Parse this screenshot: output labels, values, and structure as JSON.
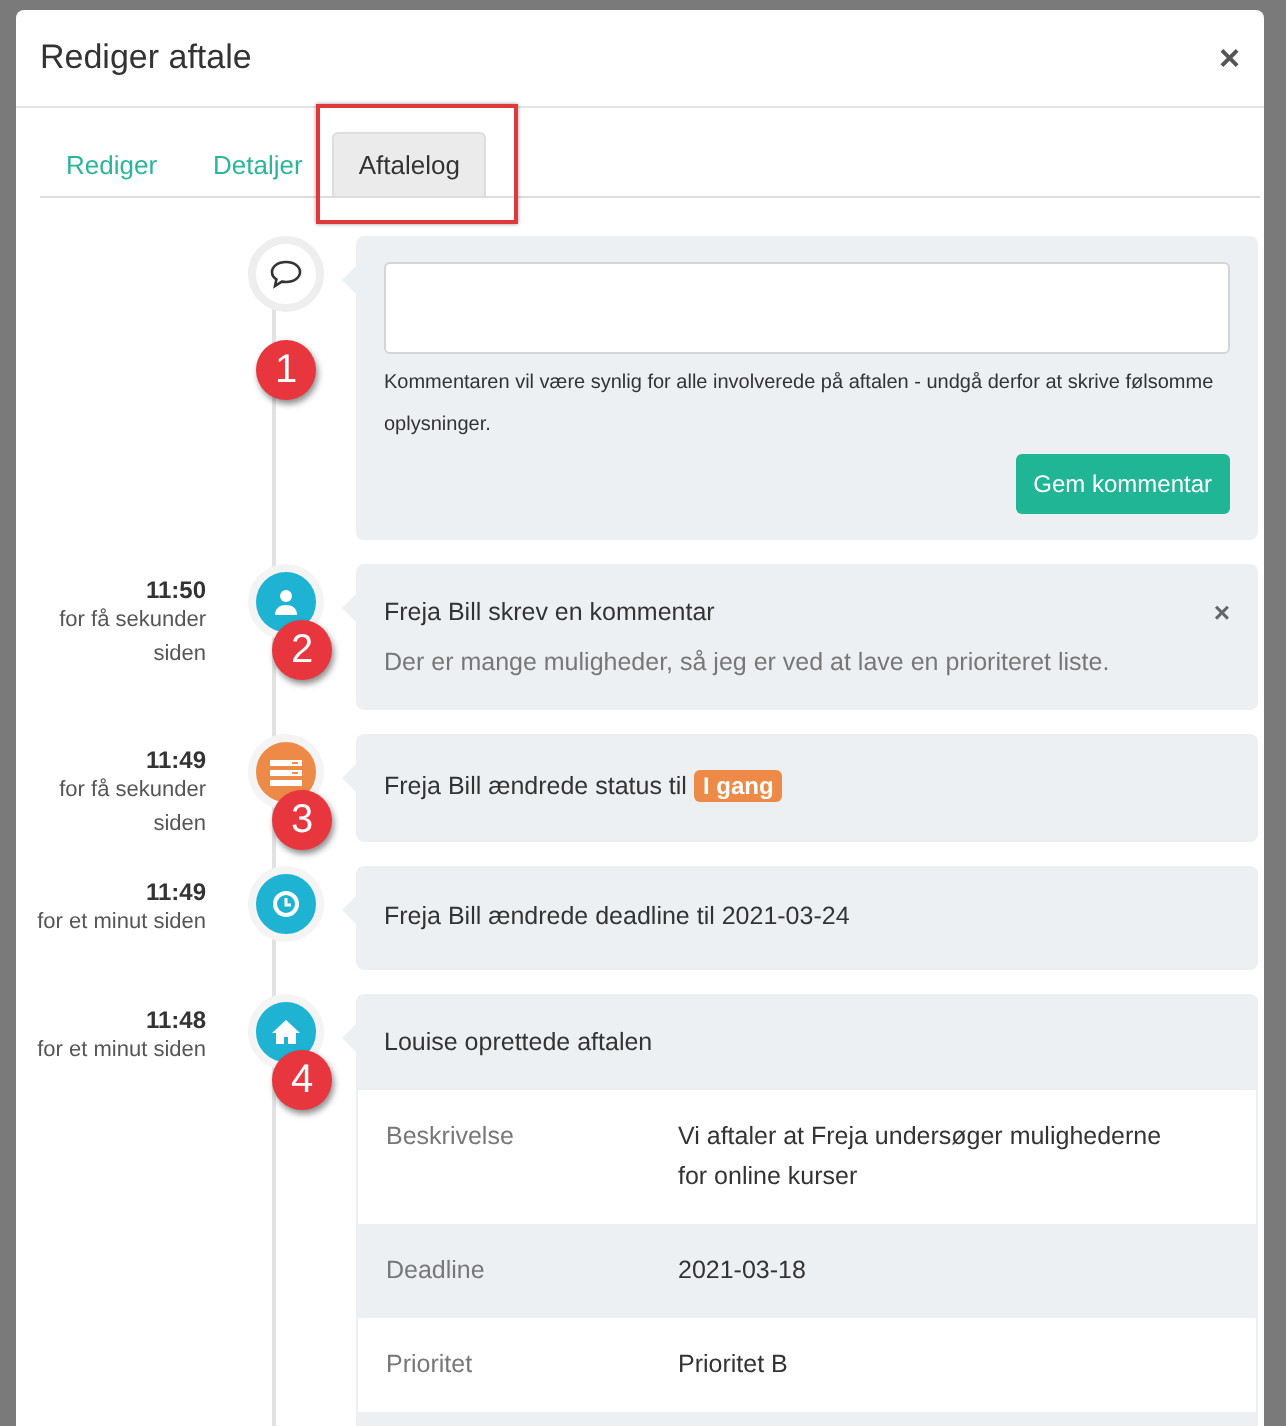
{
  "dialog": {
    "title": "Rediger aftale",
    "close": "×"
  },
  "tabs": [
    {
      "label": "Rediger",
      "selected": false,
      "highlighted": false
    },
    {
      "label": "Detaljer",
      "selected": false,
      "highlighted": false
    },
    {
      "label": "Aftalelog",
      "selected": true,
      "highlighted": true
    }
  ],
  "timeline": [
    {
      "kind": "form",
      "callout": "1",
      "hint": "Kommentaren vil være synlig for alle involverede på aftalen - undgå derfor at skrive følsomme oplysninger.",
      "button": "Gem kommentar"
    },
    {
      "kind": "comment",
      "color": "#1eb3d3",
      "time": "11:50",
      "ago": "for få sekunder siden",
      "title": "Freja Bill skrev en kommentar",
      "body": "Der er mange muligheder, så jeg er ved at lave en prioriteret liste.",
      "close": "×",
      "callout": "2"
    },
    {
      "kind": "status",
      "color": "#ee8a48",
      "time": "11:49",
      "ago": "for få sekunder siden",
      "title": "Freja Bill ændrede status til",
      "badge": "I gang",
      "callout": "3"
    },
    {
      "kind": "change",
      "color": "#1eb3d3",
      "time": "11:49",
      "ago": "for et minut siden",
      "title": "Freja Bill ændrede deadline til 2021-03-24"
    },
    {
      "kind": "created",
      "color": "#1eb3d3",
      "time": "11:48",
      "ago": "for et minut siden",
      "title": "Louise oprettede aftalen",
      "callout": "4",
      "details": [
        {
          "label": "Beskrivelse",
          "value": "Vi aftaler at Freja undersøger mulighederne for online kurser"
        },
        {
          "label": "Deadline",
          "value": "2021-03-18"
        },
        {
          "label": "Prioritet",
          "value": "Prioritet B"
        }
      ]
    }
  ]
}
